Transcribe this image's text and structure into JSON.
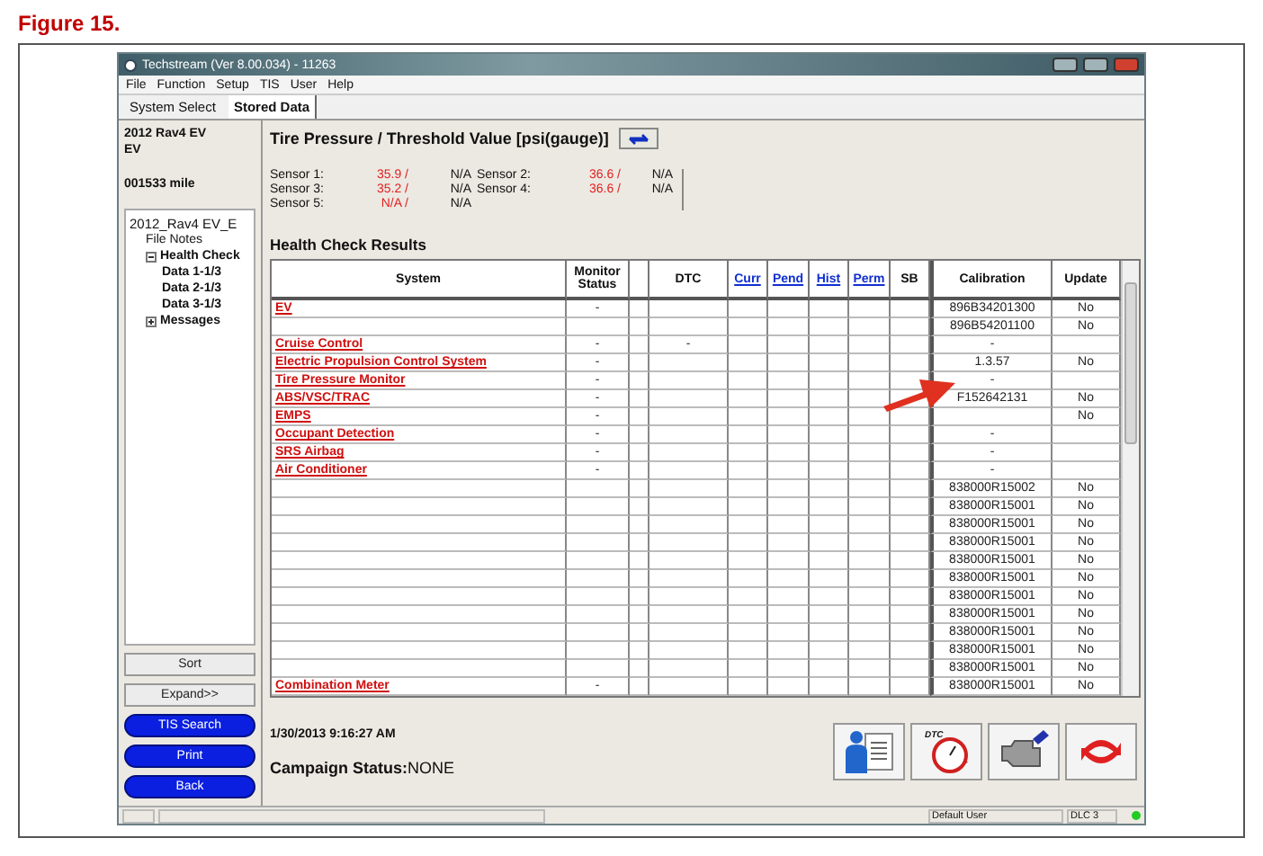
{
  "figure_caption": "Figure 15.",
  "window": {
    "title": "Techstream (Ver 8.00.034) - 11263"
  },
  "menu": [
    "File",
    "Function",
    "Setup",
    "TIS",
    "User",
    "Help"
  ],
  "tabs": [
    {
      "label": "System Select",
      "selected": false
    },
    {
      "label": "Stored Data",
      "selected": true
    }
  ],
  "vehicle": {
    "model": "2012 Rav4 EV",
    "type": "EV",
    "mileage": "001533 mile"
  },
  "tree": [
    {
      "label": "2012_Rav4 EV_E",
      "kind": "root",
      "children": [
        {
          "label": "File Notes",
          "kind": "note"
        },
        {
          "label": "Health Check",
          "kind": "folder",
          "expanded": true,
          "children": [
            {
              "label": "Data 1-1/3",
              "kind": "data"
            },
            {
              "label": "Data 2-1/3",
              "kind": "data"
            },
            {
              "label": "Data 3-1/3",
              "kind": "data"
            }
          ]
        },
        {
          "label": "Messages",
          "kind": "folder",
          "expanded": false
        }
      ]
    }
  ],
  "side_buttons": [
    {
      "label": "Sort",
      "kind": "plain"
    },
    {
      "label": "Expand>>",
      "kind": "plain"
    },
    {
      "label": "TIS Search",
      "kind": "blue"
    },
    {
      "label": "Print",
      "kind": "blue"
    },
    {
      "label": "Back",
      "kind": "blue"
    }
  ],
  "tire_pressure": {
    "title": "Tire Pressure / Threshold Value [psi(gauge)]",
    "sensors": [
      {
        "label": "Sensor 1:",
        "value": "35.9 /",
        "threshold": "N/A"
      },
      {
        "label": "Sensor 2:",
        "value": "36.6 /",
        "threshold": "N/A"
      },
      {
        "label": "Sensor 3:",
        "value": "35.2 /",
        "threshold": "N/A"
      },
      {
        "label": "Sensor 4:",
        "value": "36.6 /",
        "threshold": "N/A"
      },
      {
        "label": "Sensor 5:",
        "value": "N/A /",
        "threshold": "N/A"
      }
    ]
  },
  "health_check": {
    "title": "Health Check Results",
    "columns": [
      {
        "label": "System",
        "kind": "text"
      },
      {
        "label": "Monitor Status",
        "kind": "text"
      },
      {
        "kind": "blank"
      },
      {
        "label": "DTC",
        "kind": "text"
      },
      {
        "label": "Curr",
        "kind": "link"
      },
      {
        "label": "Pend",
        "kind": "link"
      },
      {
        "label": "Hist",
        "kind": "link"
      },
      {
        "label": "Perm",
        "kind": "link"
      },
      {
        "label": "SB",
        "kind": "text"
      },
      {
        "label": "Calibration",
        "kind": "text"
      },
      {
        "label": "Update",
        "kind": "text"
      }
    ],
    "rows": [
      {
        "system": "EV",
        "monitor": "-",
        "calibration": "896B34201300",
        "update": "No"
      },
      {
        "calibration": "896B54201100",
        "update": "No"
      },
      {
        "system": "Cruise Control",
        "monitor": "-",
        "dtc": "-",
        "calibration": "-"
      },
      {
        "system": "Electric Propulsion Control System",
        "monitor": "-",
        "calibration": "1.3.57",
        "update": "No"
      },
      {
        "system": "Tire Pressure Monitor",
        "monitor": "-",
        "calibration": "-"
      },
      {
        "system": "ABS/VSC/TRAC",
        "monitor": "-",
        "calibration": "F152642131",
        "update": "No"
      },
      {
        "system": "EMPS",
        "monitor": "-",
        "update": "No"
      },
      {
        "system": "Occupant Detection",
        "monitor": "-",
        "calibration": "-"
      },
      {
        "system": "SRS Airbag",
        "monitor": "-",
        "calibration": "-"
      },
      {
        "system": "Air Conditioner",
        "monitor": "-",
        "calibration": "-"
      },
      {
        "calibration": "838000R15002",
        "update": "No"
      },
      {
        "calibration": "838000R15001",
        "update": "No"
      },
      {
        "calibration": "838000R15001",
        "update": "No"
      },
      {
        "calibration": "838000R15001",
        "update": "No"
      },
      {
        "calibration": "838000R15001",
        "update": "No"
      },
      {
        "calibration": "838000R15001",
        "update": "No"
      },
      {
        "calibration": "838000R15001",
        "update": "No"
      },
      {
        "calibration": "838000R15001",
        "update": "No"
      },
      {
        "calibration": "838000R15001",
        "update": "No"
      },
      {
        "calibration": "838000R15001",
        "update": "No"
      },
      {
        "calibration": "838000R15001",
        "update": "No"
      },
      {
        "system": "Combination Meter",
        "monitor": "-",
        "calibration": "838000R15001",
        "update": "No"
      }
    ]
  },
  "timestamp": "1/30/2013 9:16:27 AM",
  "campaign_status": "**Campaign Status:**NONE",
  "tool_buttons": [
    {
      "kind": "report"
    },
    {
      "kind": "dtc",
      "label": "DTC"
    },
    {
      "kind": "engine"
    },
    {
      "kind": "refresh"
    }
  ],
  "status_bar": {
    "user": "Default User",
    "connection": "DLC 3"
  }
}
